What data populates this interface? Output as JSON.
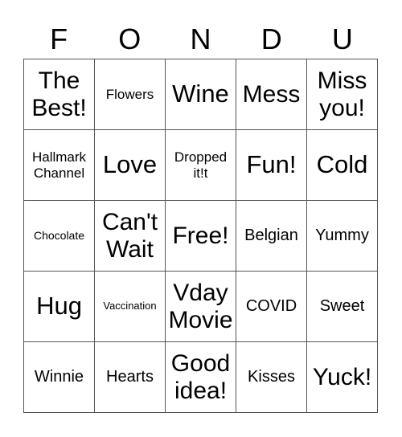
{
  "header": [
    "F",
    "O",
    "N",
    "D",
    "U"
  ],
  "cells": [
    [
      "The Best!",
      "Flowers",
      "Wine",
      "Mess",
      "Miss you!"
    ],
    [
      "Hallmark Channel",
      "Love",
      "Dropped it!t",
      "Fun!",
      "Cold"
    ],
    [
      "Chocolate",
      "Can't Wait",
      "Free!",
      "Belgian",
      "Yummy"
    ],
    [
      "Hug",
      "Vaccination",
      "Vday Movie",
      "COVID",
      "Sweet"
    ],
    [
      "Winnie",
      "Hearts",
      "Good idea!",
      "Kisses",
      "Yuck!"
    ]
  ]
}
